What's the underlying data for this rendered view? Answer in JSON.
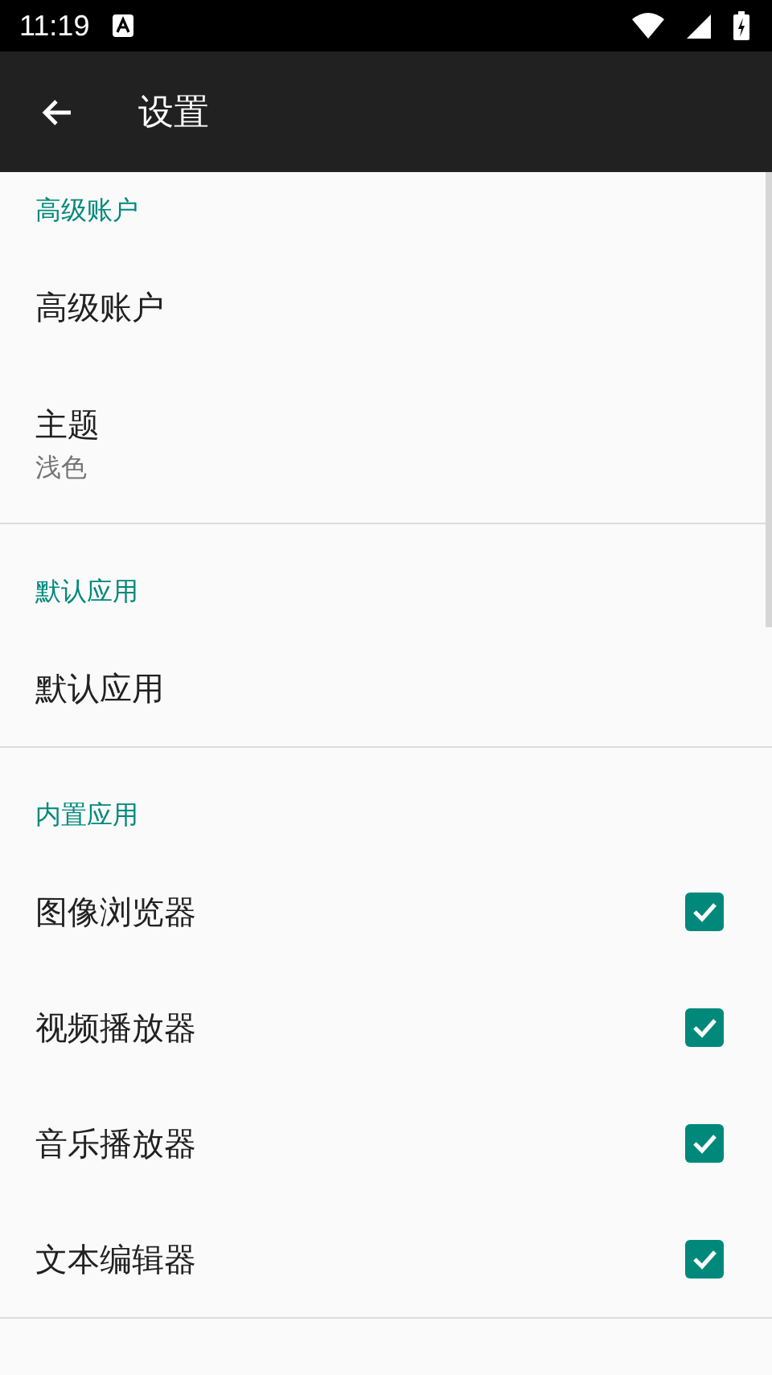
{
  "status_bar": {
    "time": "11:19"
  },
  "toolbar": {
    "title": "设置"
  },
  "sections": [
    {
      "header": "高级账户",
      "items": [
        {
          "kind": "plain",
          "title": "高级账户"
        },
        {
          "kind": "plain",
          "title": "主题",
          "subtitle": "浅色"
        }
      ]
    },
    {
      "header": "默认应用",
      "items": [
        {
          "kind": "plain",
          "title": "默认应用"
        }
      ]
    },
    {
      "header": "内置应用",
      "items": [
        {
          "kind": "checkbox",
          "title": "图像浏览器",
          "checked": true
        },
        {
          "kind": "checkbox",
          "title": "视频播放器",
          "checked": true
        },
        {
          "kind": "checkbox",
          "title": "音乐播放器",
          "checked": true
        },
        {
          "kind": "checkbox",
          "title": "文本编辑器",
          "checked": true
        }
      ]
    }
  ]
}
